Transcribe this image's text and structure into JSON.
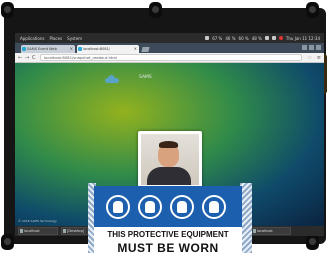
{
  "desktop": {
    "top_panel": {
      "menus": [
        "Applications",
        "Places",
        "System"
      ],
      "tray_readouts": [
        "67 %",
        "46 %",
        "60 %",
        "48 %"
      ],
      "clock": "Thu Jan 11 12:34"
    },
    "taskbar": {
      "tasks": [
        "localhost",
        "[Desktop]",
        "localhost",
        "localhost"
      ]
    }
  },
  "browser": {
    "tabs": [
      {
        "label": "SAMS Event Web",
        "active": false
      },
      {
        "label": "localhost:8081/",
        "active": true
      }
    ],
    "url": "localhost:8081/snapshot_readout.html",
    "nav": {
      "back": "←",
      "forward": "→",
      "reload": "C",
      "star": "☆",
      "menu": "≡"
    }
  },
  "page": {
    "brand": "SAMS",
    "footer": "© 2018 SAMS Technology"
  },
  "sign": {
    "line1": "THIS PROTECTIVE EQUIPMENT",
    "line2": "MUST BE WORN",
    "icons": [
      "goggles-icon",
      "helmet-icon",
      "boot-icon",
      "coverall-icon"
    ]
  },
  "colors": {
    "sign_blue": "#1b5fae",
    "panel_dark": "#2b2b2b",
    "page_green": "#93b21e",
    "page_navy": "#0a2340"
  }
}
